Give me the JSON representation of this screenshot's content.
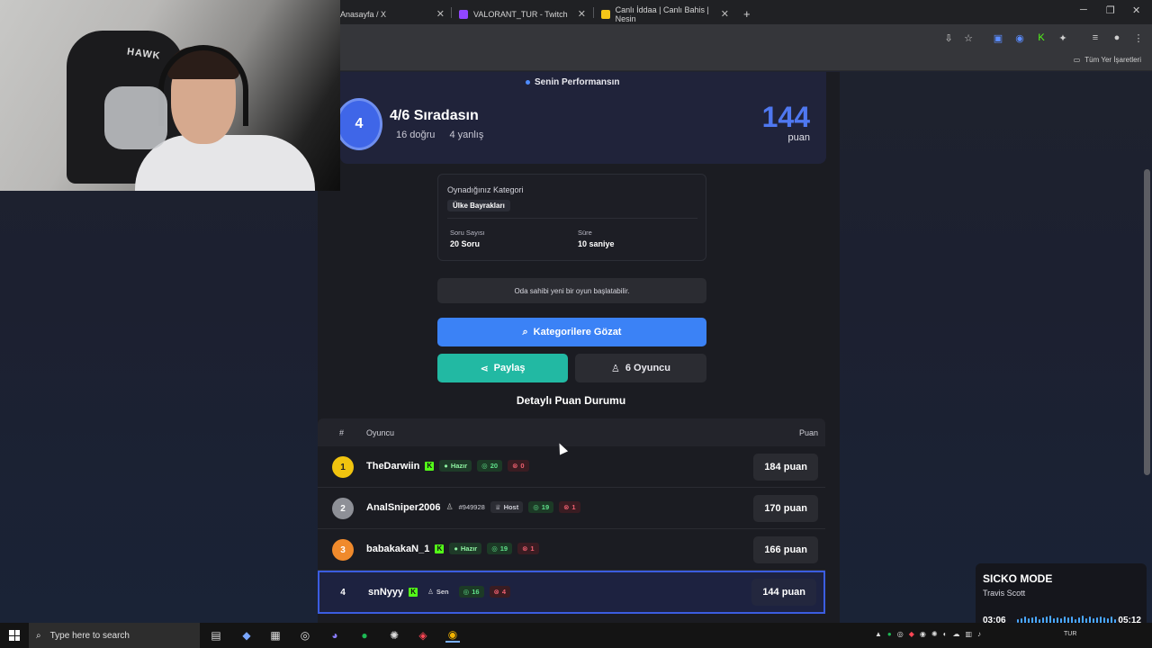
{
  "browser": {
    "tabs": [
      {
        "label": "Anasayfa / X",
        "color": "#000000"
      },
      {
        "label": "VALORANT_TUR - Twitch",
        "color": "#9146ff"
      },
      {
        "label": "Canlı İddaa | Canlı Bahis | Nesin",
        "color": "#f5c518"
      }
    ],
    "new_tab": "+",
    "bookmarks_label": "Tüm Yer İşaretleri"
  },
  "performance": {
    "label": "Senin Performansın",
    "rank": "4",
    "rank_text": "4/6 Sıradasın",
    "correct": "16 doğru",
    "wrong": "4 yanlış",
    "score": "144",
    "score_unit": "puan"
  },
  "category": {
    "heading": "Oynadığınız Kategori",
    "name": "Ülke Bayrakları",
    "q_key": "Soru Sayısı",
    "q_val": "20 Soru",
    "t_key": "Süre",
    "t_val": "10 saniye"
  },
  "notice": "Oda sahibi yeni bir oyun başlatabilir.",
  "buttons": {
    "browse": "Kategorilere Gözat",
    "share": "Paylaş",
    "players": "6 Oyuncu"
  },
  "detail_title": "Detaylı Puan Durumu",
  "table": {
    "headers": {
      "rank": "#",
      "player": "Oyuncu",
      "points": "Puan"
    },
    "rows": [
      {
        "rank": "1",
        "name": "TheDarwiin",
        "tag": "Hazır",
        "ok": "20",
        "bad": "0",
        "points": "184 puan",
        "color": "#f1c40f"
      },
      {
        "rank": "2",
        "name": "AnalSniper2006",
        "id": "#949928",
        "tag": "Host",
        "ok": "19",
        "bad": "1",
        "points": "170 puan",
        "color": "#8e9097"
      },
      {
        "rank": "3",
        "name": "babakakaN_1",
        "tag": "Hazır",
        "ok": "19",
        "bad": "1",
        "points": "166 puan",
        "color": "#f08a2c"
      },
      {
        "rank": "4",
        "name": "snNyyy",
        "tag": "Sen",
        "ok": "16",
        "bad": "4",
        "points": "144 puan",
        "color": "transparent"
      }
    ]
  },
  "webcam": {
    "chair_logo": "HAWK"
  },
  "now_playing": {
    "title": "SICKO MODE",
    "artist": "Travis Scott",
    "elapsed": "03:06",
    "total": "05:12"
  },
  "taskbar": {
    "search_placeholder": "Type here to search",
    "lang": "TUR"
  }
}
